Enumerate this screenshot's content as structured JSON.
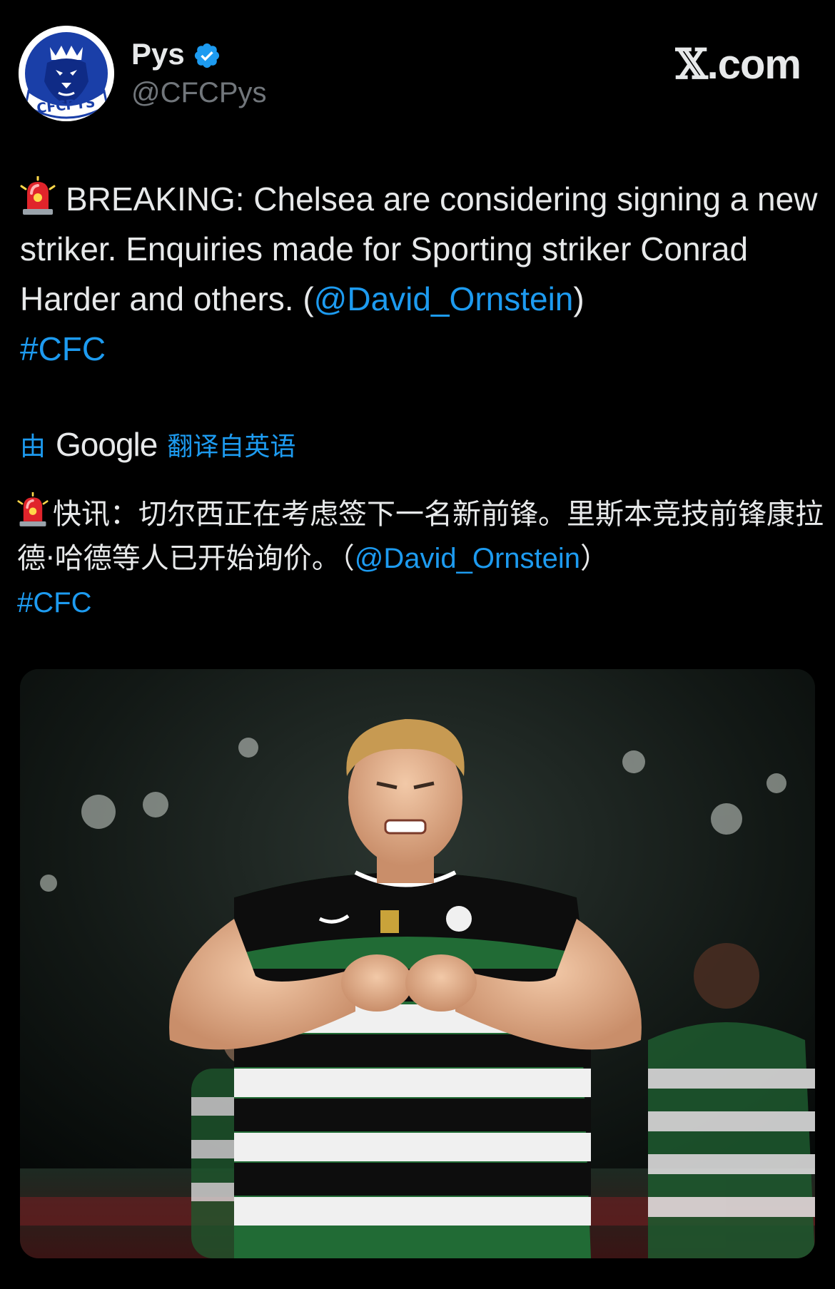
{
  "author": {
    "display_name": "Pys",
    "handle": "@CFCPys",
    "avatar_text": "CFCPYS",
    "verified": true
  },
  "brand": {
    "logo_text": ".com"
  },
  "tweet": {
    "text_before": "BREAKING: Chelsea are considering signing a new striker. Enquiries made for Sporting striker Conrad Harder and others. (",
    "mention": "@David_Ornstein",
    "text_after": ")",
    "hashtag": "#CFC"
  },
  "translation": {
    "by_label": "由",
    "provider": "Google",
    "from_label": "翻译自英语",
    "text_before": "快讯：切尔西正在考虑签下一名新前锋。里斯本竞技前锋康拉德·哈德等人已开始询价。（",
    "mention": "@David_Ornstein",
    "text_after": "）",
    "hashtag": "#CFC"
  },
  "colors": {
    "background": "#000000",
    "text": "#e7e9ea",
    "secondary_text": "#71767b",
    "link": "#1d9bf0",
    "verified_badge": "#1d9bf0"
  },
  "icons": {
    "siren": "siren-icon",
    "verified": "verified-badge-icon",
    "avatar": "lion-crest-logo"
  }
}
